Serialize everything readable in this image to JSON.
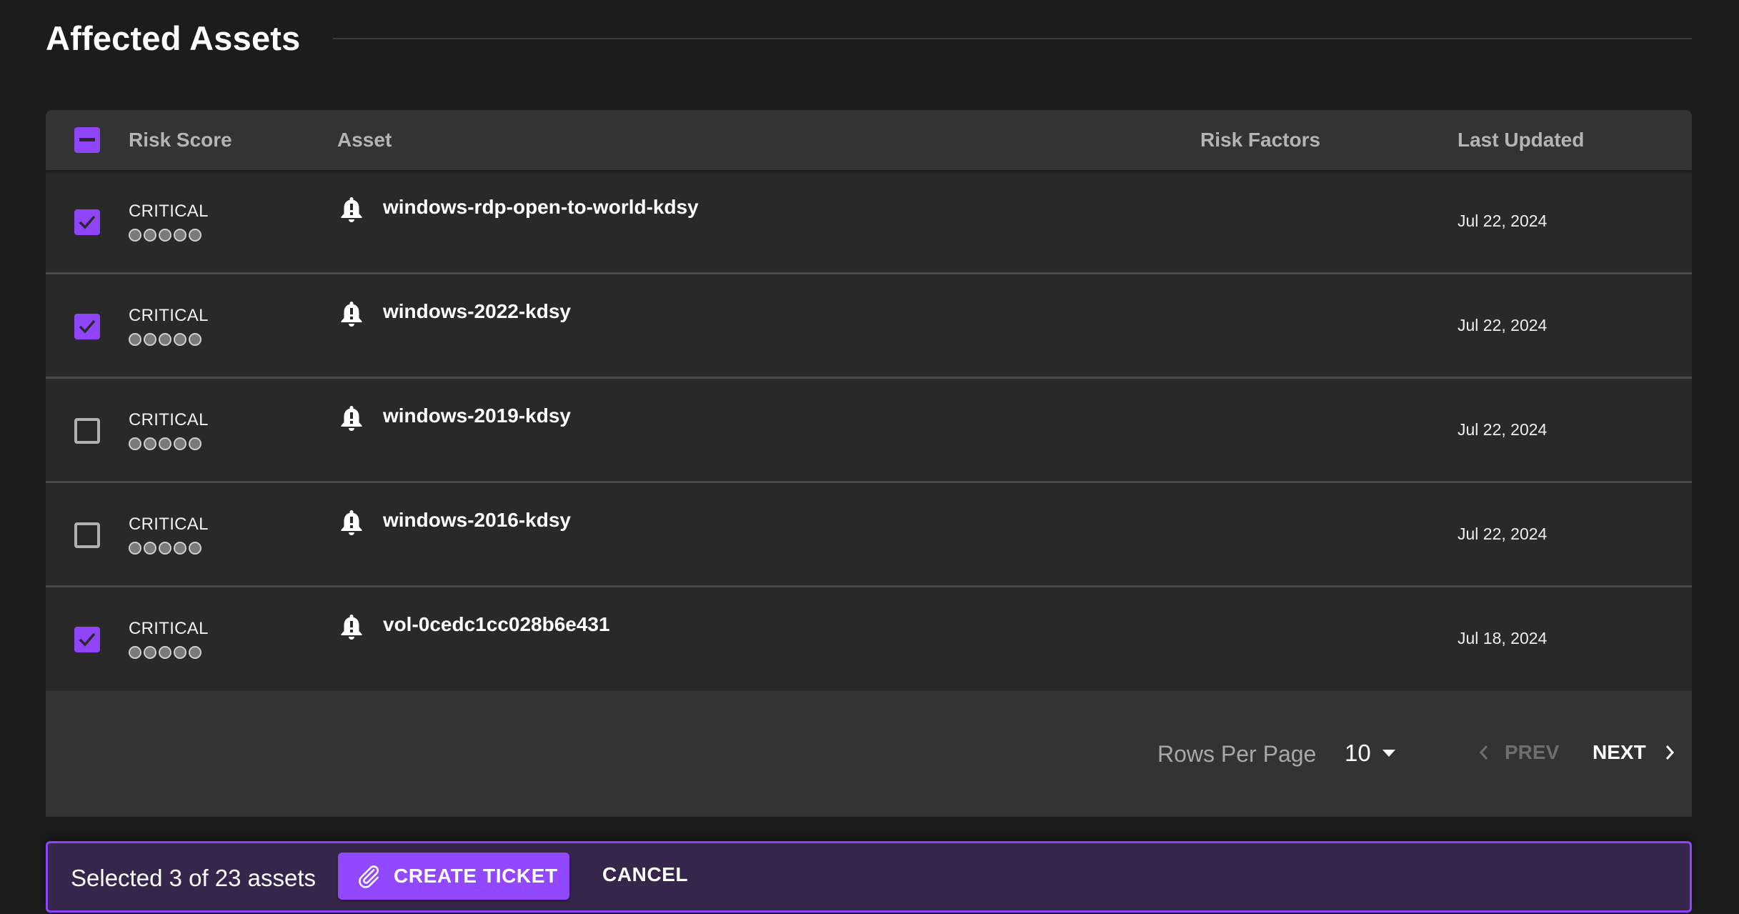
{
  "section": {
    "title": "Affected Assets"
  },
  "table": {
    "columns": {
      "risk_score": "Risk Score",
      "asset": "Asset",
      "risk_factors": "Risk Factors",
      "last_updated": "Last Updated"
    },
    "select_all_state": "indeterminate",
    "rows": [
      {
        "selected": true,
        "severity": "CRITICAL",
        "risk_dots_filled": 0,
        "risk_dots_total": 5,
        "asset_icon": "bell-alert-icon",
        "asset": "windows-rdp-open-to-world-kdsy",
        "risk_factors": "",
        "last_updated": "Jul 22, 2024"
      },
      {
        "selected": true,
        "severity": "CRITICAL",
        "risk_dots_filled": 0,
        "risk_dots_total": 5,
        "asset_icon": "bell-alert-icon",
        "asset": "windows-2022-kdsy",
        "risk_factors": "",
        "last_updated": "Jul 22, 2024"
      },
      {
        "selected": false,
        "severity": "CRITICAL",
        "risk_dots_filled": 0,
        "risk_dots_total": 5,
        "asset_icon": "bell-alert-icon",
        "asset": "windows-2019-kdsy",
        "risk_factors": "",
        "last_updated": "Jul 22, 2024"
      },
      {
        "selected": false,
        "severity": "CRITICAL",
        "risk_dots_filled": 0,
        "risk_dots_total": 5,
        "asset_icon": "bell-alert-icon",
        "asset": "windows-2016-kdsy",
        "risk_factors": "",
        "last_updated": "Jul 22, 2024"
      },
      {
        "selected": true,
        "severity": "CRITICAL",
        "risk_dots_filled": 0,
        "risk_dots_total": 5,
        "asset_icon": "bell-alert-icon",
        "asset": "vol-0cedc1cc028b6e431",
        "risk_factors": "",
        "last_updated": "Jul 18, 2024"
      }
    ],
    "pagination": {
      "rows_per_page_label": "Rows Per Page",
      "rows_per_page_value": "10",
      "prev_label": "PREV",
      "prev_enabled": false,
      "next_label": "NEXT",
      "next_enabled": true
    }
  },
  "action_bar": {
    "selected_text": "Selected 3 of 23 assets",
    "create_ticket_label": "CREATE TICKET",
    "cancel_label": "CANCEL"
  },
  "colors": {
    "accent": "#9148ff",
    "action_bar_bg": "#36264b",
    "page_bg": "#1c1c1c"
  }
}
